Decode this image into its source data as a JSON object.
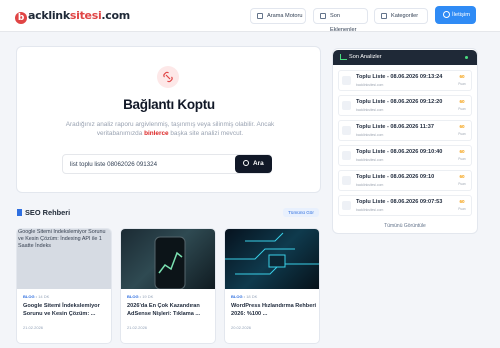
{
  "header": {
    "logo_prefix": "b",
    "logo_mid": "acklink",
    "logo_hl": "sitesi",
    "logo_suffix": ".com",
    "nav": [
      "Arama Motoru",
      "Son Eklenenler",
      "Kategoriler"
    ],
    "cta": "İletişim"
  },
  "error": {
    "title": "Bağlantı Koptu",
    "desc_1": "Aradığınız analiz raporu argivlenmiş, taşınmış veya silinmiş olabilir. Ancak veritabanımızda",
    "desc_bold": "binlerce",
    "desc_2": "başka site analizi mevcut.",
    "search_value": "list toplu liste 08062026 091324",
    "search_button": "Ara"
  },
  "recent": {
    "title": "Son Analizler",
    "rows": [
      {
        "title": "Toplu Liste - 08.06.2026 09:13:24",
        "sub": "backlinksitesi.com",
        "score": "60",
        "unit": "Puan"
      },
      {
        "title": "Toplu Liste - 08.06.2026 09:12:20",
        "sub": "backlinksitesi.com",
        "score": "60",
        "unit": "Puan"
      },
      {
        "title": "Toplu Liste - 08.06.2026 11:37",
        "sub": "backlinksitesi.com",
        "score": "60",
        "unit": "Puan"
      },
      {
        "title": "Toplu Liste - 08.06.2026 09:10:40",
        "sub": "backlinksitesi.com",
        "score": "60",
        "unit": "Puan"
      },
      {
        "title": "Toplu Liste - 08.06.2026 09:10",
        "sub": "backlinksitesi.com",
        "score": "60",
        "unit": "Puan"
      },
      {
        "title": "Toplu Liste - 08.06.2026 09:07:53",
        "sub": "backlinksitesi.com",
        "score": "60",
        "unit": "Puan"
      }
    ],
    "more": "Tümünü Görüntüle"
  },
  "seo": {
    "title": "SEO Rehberi",
    "all": "Tümünü Gör",
    "posts": [
      {
        "alt": "Google Sitemi İndekslemiyor Sorunu ve Kesin Çözüm: İndexing API ile 1 Saatte İndeks",
        "cat": "BLOG",
        "time": "14 DK",
        "title": "Google Sitemi İndekslemiyor Sorunu ve Kesin Çözüm: ...",
        "date": "21.02.2026"
      },
      {
        "cat": "BLOG",
        "time": "19 DK",
        "title": "2026'da En Çok Kazandıran AdSense Nişleri: Tıklama ...",
        "date": "21.02.2026"
      },
      {
        "cat": "BLOG",
        "time": "18 DK",
        "title": "WordPress Hızlandırma Rehberi 2026: %100 ...",
        "date": "20.02.2026"
      }
    ]
  },
  "colors": {
    "accent": "#2f8bf5",
    "danger": "#e04545",
    "dark": "#111827"
  }
}
